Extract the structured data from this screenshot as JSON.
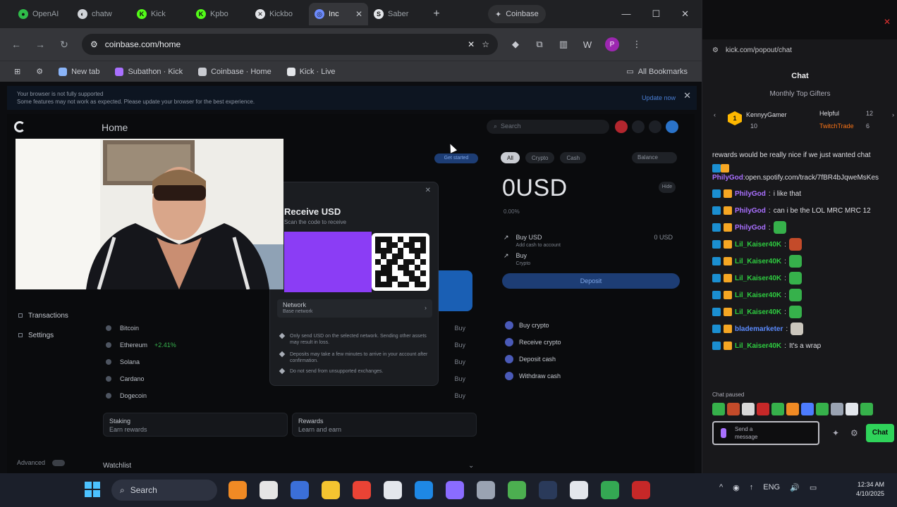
{
  "browser": {
    "tabs": [
      {
        "label": "OpenAI",
        "fav_color": "#2fbd4a",
        "fav_glyph": "●"
      },
      {
        "label": "chatw",
        "fav_color": "#d0d3d8",
        "fav_glyph": "◐"
      },
      {
        "label": "Kick",
        "fav_color": "#53fc18",
        "fav_glyph": "K"
      },
      {
        "label": "Kpbo",
        "fav_color": "#53fc18",
        "fav_glyph": "K"
      },
      {
        "label": "Kickbo",
        "fav_color": "#e3e5e9",
        "fav_glyph": "✕"
      },
      {
        "label": "Inc",
        "fav_color": "#6d8cff",
        "fav_glyph": "◎",
        "active": true
      },
      {
        "label": "Saber",
        "fav_color": "#e3e5e9",
        "fav_glyph": "S"
      }
    ],
    "tab_search_label": "Coinbase",
    "url": "coinbase.com/home",
    "profile_initial": "P",
    "bookmarks": [
      {
        "label": "New tab",
        "color": "#8ab4f8"
      },
      {
        "label": "Subathon · Kick",
        "color": "#a970ff"
      },
      {
        "label": "Coinbase · Home",
        "color": "#c8cad0"
      },
      {
        "label": "Kick · Live",
        "color": "#e3e5e9"
      }
    ],
    "bookmarks_right": "All Bookmarks",
    "banner": {
      "line1": "Your browser is not fully supported",
      "line2": "Some features may not work as expected. Please update your browser for the best experience.",
      "link": "Update now"
    }
  },
  "coinbase": {
    "page_title": "Home",
    "search_placeholder": "Search",
    "sidebar_items": [
      "Transactions",
      "Settings"
    ],
    "footer_label": "Advanced",
    "assets": [
      {
        "name": "Bitcoin",
        "change": "",
        "action": "Buy"
      },
      {
        "name": "Ethereum",
        "change": "+2.41%",
        "action": "Buy"
      },
      {
        "name": "Solana",
        "change": "",
        "action": "Buy"
      },
      {
        "name": "Cardano",
        "change": "",
        "action": "Buy"
      },
      {
        "name": "Dogecoin",
        "change": "",
        "action": "Buy"
      }
    ],
    "card_left": {
      "title": "Staking",
      "sub": "Earn rewards"
    },
    "card_right": {
      "title": "Rewards",
      "sub": "Learn and earn"
    },
    "section_title": "Watchlist",
    "modal": {
      "title": "Receive USD",
      "subtitle": "Scan the code to receive",
      "network_label": "Network",
      "network_sub": "Base network",
      "warnings": [
        "Only send USD on the selected network. Sending other assets may result in loss.",
        "Deposits may take a few minutes to arrive in your account after confirmation.",
        "Do not send from unsupported exchanges."
      ]
    },
    "right_panel": {
      "tabs": [
        "All",
        "Crypto",
        "Cash"
      ],
      "dropdown": "Balance",
      "balance": "0USD",
      "balance_sub": "0.00%",
      "balance_btn": "Hide",
      "rows": [
        {
          "title": "Buy USD",
          "sub": "Add cash to account",
          "right": "0 USD"
        },
        {
          "title": "Buy",
          "sub": "Crypto"
        }
      ],
      "cta": "Deposit",
      "links": [
        "Buy crypto",
        "Receive crypto",
        "Deposit cash",
        "Withdraw cash"
      ]
    },
    "small_button": "Get started"
  },
  "chat": {
    "url": "kick.com/popout/chat",
    "title": "Chat",
    "subtitle": "Monthly Top Gifters",
    "gifters": [
      {
        "rank": "1",
        "name": "KennyyGamer",
        "count": "10"
      },
      {
        "name": "Helpful",
        "count": "12"
      },
      {
        "name": "TwitchTrade",
        "count": "6"
      }
    ],
    "messages": [
      {
        "wrap": true,
        "text": "rewards would be really nice if we just wanted chat"
      },
      {
        "wrap": true,
        "user": "PhilyGod",
        "user_style": "p",
        "text": "open.spotify.com/track/7fBR4bJqweMsKes"
      },
      {
        "user": "PhilyGod",
        "user_style": "p",
        "text": "i like that"
      },
      {
        "user": "PhilyGod",
        "user_style": "p",
        "text": "can i be the LOL MRC MRC 12"
      },
      {
        "user": "PhilyGod",
        "user_style": "p",
        "text": "",
        "emote": "green"
      },
      {
        "user": "Lil_Kaiser40K",
        "user_style": "g",
        "text": "",
        "emote": "red"
      },
      {
        "user": "Lil_Kaiser40K",
        "user_style": "g",
        "text": "",
        "emote": "green"
      },
      {
        "user": "Lil_Kaiser40K",
        "user_style": "g",
        "text": "",
        "emote": "green"
      },
      {
        "user": "Lil_Kaiser40K",
        "user_style": "g",
        "text": "",
        "emote": "green"
      },
      {
        "user": "Lil_Kaiser40K",
        "user_style": "g",
        "text": "",
        "emote": "green"
      },
      {
        "user": "blademarketer",
        "user_style": "b",
        "text": "",
        "emote": "grey"
      },
      {
        "user": "Lil_Kaiser40K",
        "user_style": "g",
        "text": "It's a wrap"
      }
    ],
    "note": "Chat paused",
    "input_placeholder_1": "Send a",
    "input_placeholder_2": "message",
    "send_label": "Chat"
  },
  "taskbar": {
    "search_label": "Search",
    "apps": [
      "#f08a24",
      "#e5e5e5",
      "#3b6fd8",
      "#f4c430",
      "#ea4335",
      "#e3e6ec",
      "#1e88e5",
      "#8a6cff",
      "#9aa3b2",
      "#4caf50",
      "#2a3a5a",
      "#e3e6ec",
      "#34a853",
      "#c62828"
    ],
    "tray": [
      "^",
      "◉",
      "↑",
      "ENG",
      "🔊",
      "▭"
    ],
    "time": "12:34 AM",
    "date": "4/10/2025"
  }
}
